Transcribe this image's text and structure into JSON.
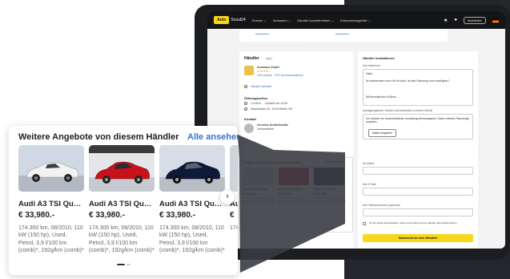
{
  "tablet": {
    "nav": {
      "logo_box": "Auto",
      "logo_rest": "Scout24",
      "items": [
        "Suchen ⌄",
        "Verkaufen ⌄",
        "Händler Auslieferheiten ⌄",
        "Entscheidungshilfe ⌄"
      ],
      "login_label": "Anmelden"
    },
    "dealer_heading": "Händler",
    "dealer_badge": "Neu",
    "dealer_name": "Autohaus GmbH",
    "stars": "★★★★☆",
    "reviews": "133 reviews · 97% recommendations",
    "website_link": "Händler Website",
    "hours_heading": "Öffnungszeiten",
    "hours_status": "Geöffnet",
    "hours_text": "Schließt um 19:00",
    "address": "Hauptstraße 92, 10115 Berlin, DE",
    "contact_heading": "Kontakt",
    "contact_person": "Vernidos Seefarthmidte",
    "contact_role": "Verkaufsleiter",
    "form": {
      "title": "Händler kontaktieren",
      "message_label": "Ihre Nachricht",
      "message_lines": [
        "Hallo,",
        "ich interessiere mich für Ihr Auto. Ist das Fahrzeug noch verfügbar?",
        "Mit freundlichen Grüßen,"
      ],
      "extra_label": "Anfrageergebnis: Kaufen und verkaufen in einem Schritt",
      "extra_text": "Ich möchte ein unverbindliches Inzahlungnahmeangebot. Daten meines Fahrzeugs angeben",
      "extra_button": "Daten eingeben",
      "name_label": "Ihr Name",
      "email_label": "Ihre E-Mail",
      "phone_label": "Ihre Telefonnummer (optional)",
      "consent_text": "Ich bin damit einverstanden, dass meine Daten an den Händler übermittelt werden.",
      "submit_label": "Nachricht an den Händler"
    },
    "mini_listing": {
      "title": "Weitere Angebote von diesem Händler",
      "link": "Alle ansehen",
      "cards": [
        {
          "title": "Audi A3 TSI Quatt...",
          "price": "€ 33,980.-",
          "desc": "174.300 km, 08/2010, 110 kW (150 hp), Used, Petrol, 3,9 l/100 km (comb)*, 192g/km (comb)*"
        },
        {
          "title": "Audi A3 TSI Quatt...",
          "price": "€ 33,980.-",
          "desc": "174.300 km, 08/2010, 110 kW (150 hp), Used, Petrol, 3,9 l/100 km (comb)*, 192g/km (comb)*"
        },
        {
          "title": "Audi A3 TSI Quat...",
          "price": "€ 33,980.-",
          "desc": "174.300 km, 08/2010, 110 kW (150 hp), Used, Petrol, 3,9 l/100 km (comb)*, 192g/km (comb)*"
        }
      ]
    }
  },
  "main_card": {
    "title": "Weitere Angebote von diesem Händler",
    "link": "Alle ansehen",
    "cars": [
      {
        "title": "Audi A3 TSI Quatt...",
        "price": "€ 33,980.-",
        "desc": "174.300 km, 08/2010, 110 kW (150 hp), Used, Petrol, 3,9 l/100 km (comb)*, 192g/km (comb)*",
        "color": "#f2f2f2",
        "bg": "#cfd8e3"
      },
      {
        "title": "Audi A3 TSI Quatt...",
        "price": "€ 33,980.-",
        "desc": "174.300 km, 08/2010, 110 kW (150 hp), Used, Petrol, 3,9 l/100 km (comb)*, 192g/km (comb)*",
        "color": "#c8121b",
        "bg": "#e4e6ea"
      },
      {
        "title": "Audi A3 TSI Quat...",
        "price": "€ 33,980.-",
        "desc": "174.300 km, 08/2010, 110 kW (150 hp), Used, Petrol, 3,9 l/100 km (comb)*, 192g/km (comb)*",
        "color": "#0f1a3a",
        "bg": "#d7dde6"
      },
      {
        "title": "Au",
        "price": "€",
        "desc": "174. kW ( Petr (cor",
        "color": "#444",
        "bg": "#d0d4da"
      }
    ],
    "next_icon": "›",
    "pager_active_index": 0
  },
  "colors": {
    "brand_yellow": "#f7d61b",
    "link_blue": "#3b6fd1",
    "dark": "#24262b"
  }
}
